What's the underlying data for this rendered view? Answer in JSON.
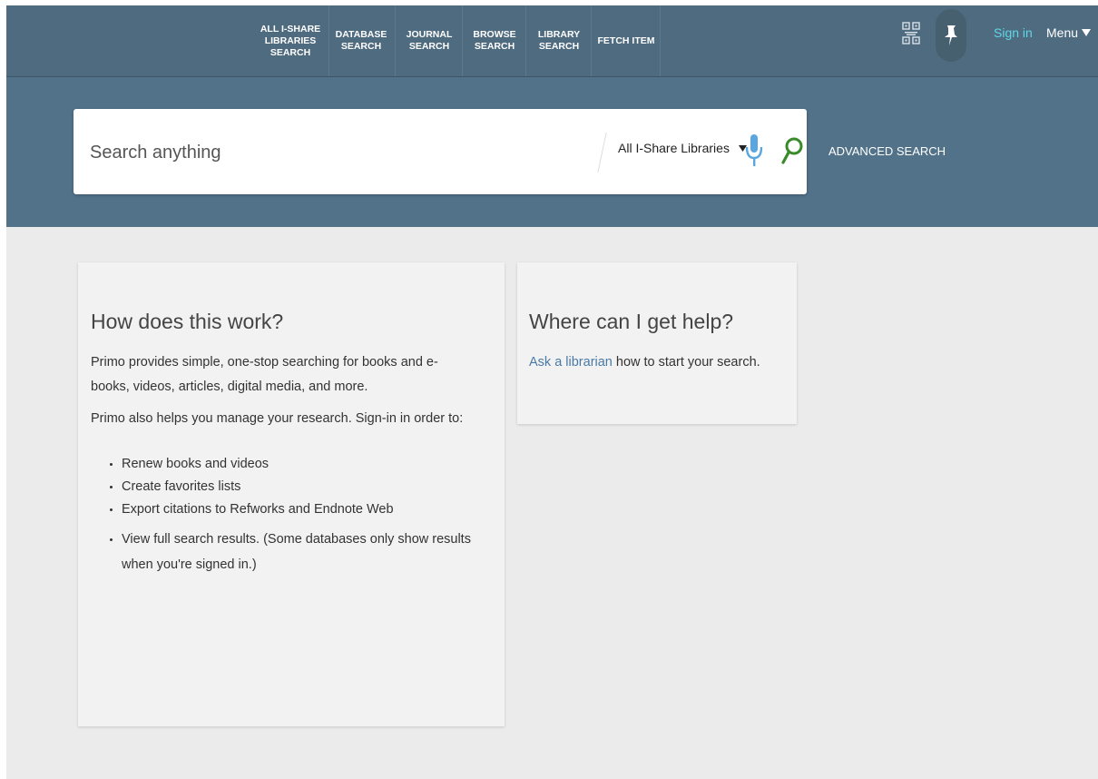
{
  "nav": {
    "items": [
      "ALL I-SHARE\nLIBRARIES\nSEARCH",
      "DATABASE\nSEARCH",
      "JOURNAL\nSEARCH",
      "BROWSE\nSEARCH",
      "LIBRARY\nSEARCH",
      "FETCH ITEM"
    ],
    "sign_in": "Sign in",
    "menu": "Menu"
  },
  "search": {
    "placeholder": "Search anything",
    "scope": "All I-Share Libraries",
    "advanced": "ADVANCED SEARCH"
  },
  "card_how": {
    "title": "How does this work?",
    "para1": "Primo provides simple, one-stop searching for books and e-books, videos, articles, digital media, and more.",
    "para2": "Primo also helps you manage your research. Sign-in in order to:",
    "list": [
      "Renew books and videos",
      "Create favorites lists",
      "Export citations to Refworks and Endnote Web",
      "View full search results. (Some databases only show results when you're signed in.)"
    ]
  },
  "card_help": {
    "title": "Where can I get help?",
    "link": "Ask a librarian",
    "text": " how to start your search."
  },
  "colors": {
    "topbar": "#4f6b80",
    "search_band": "#52728a",
    "sign_in": "#5fd6e6",
    "mic": "#5aa6e0",
    "search_icon": "#3a8a2a",
    "link": "#4a7aa6"
  },
  "icons": {
    "qr": "qr-code-icon",
    "pin": "pushpin-icon",
    "menu_caret": "caret-down-icon",
    "scope_caret": "caret-down-icon",
    "mic": "microphone-icon",
    "search": "magnifier-icon"
  }
}
